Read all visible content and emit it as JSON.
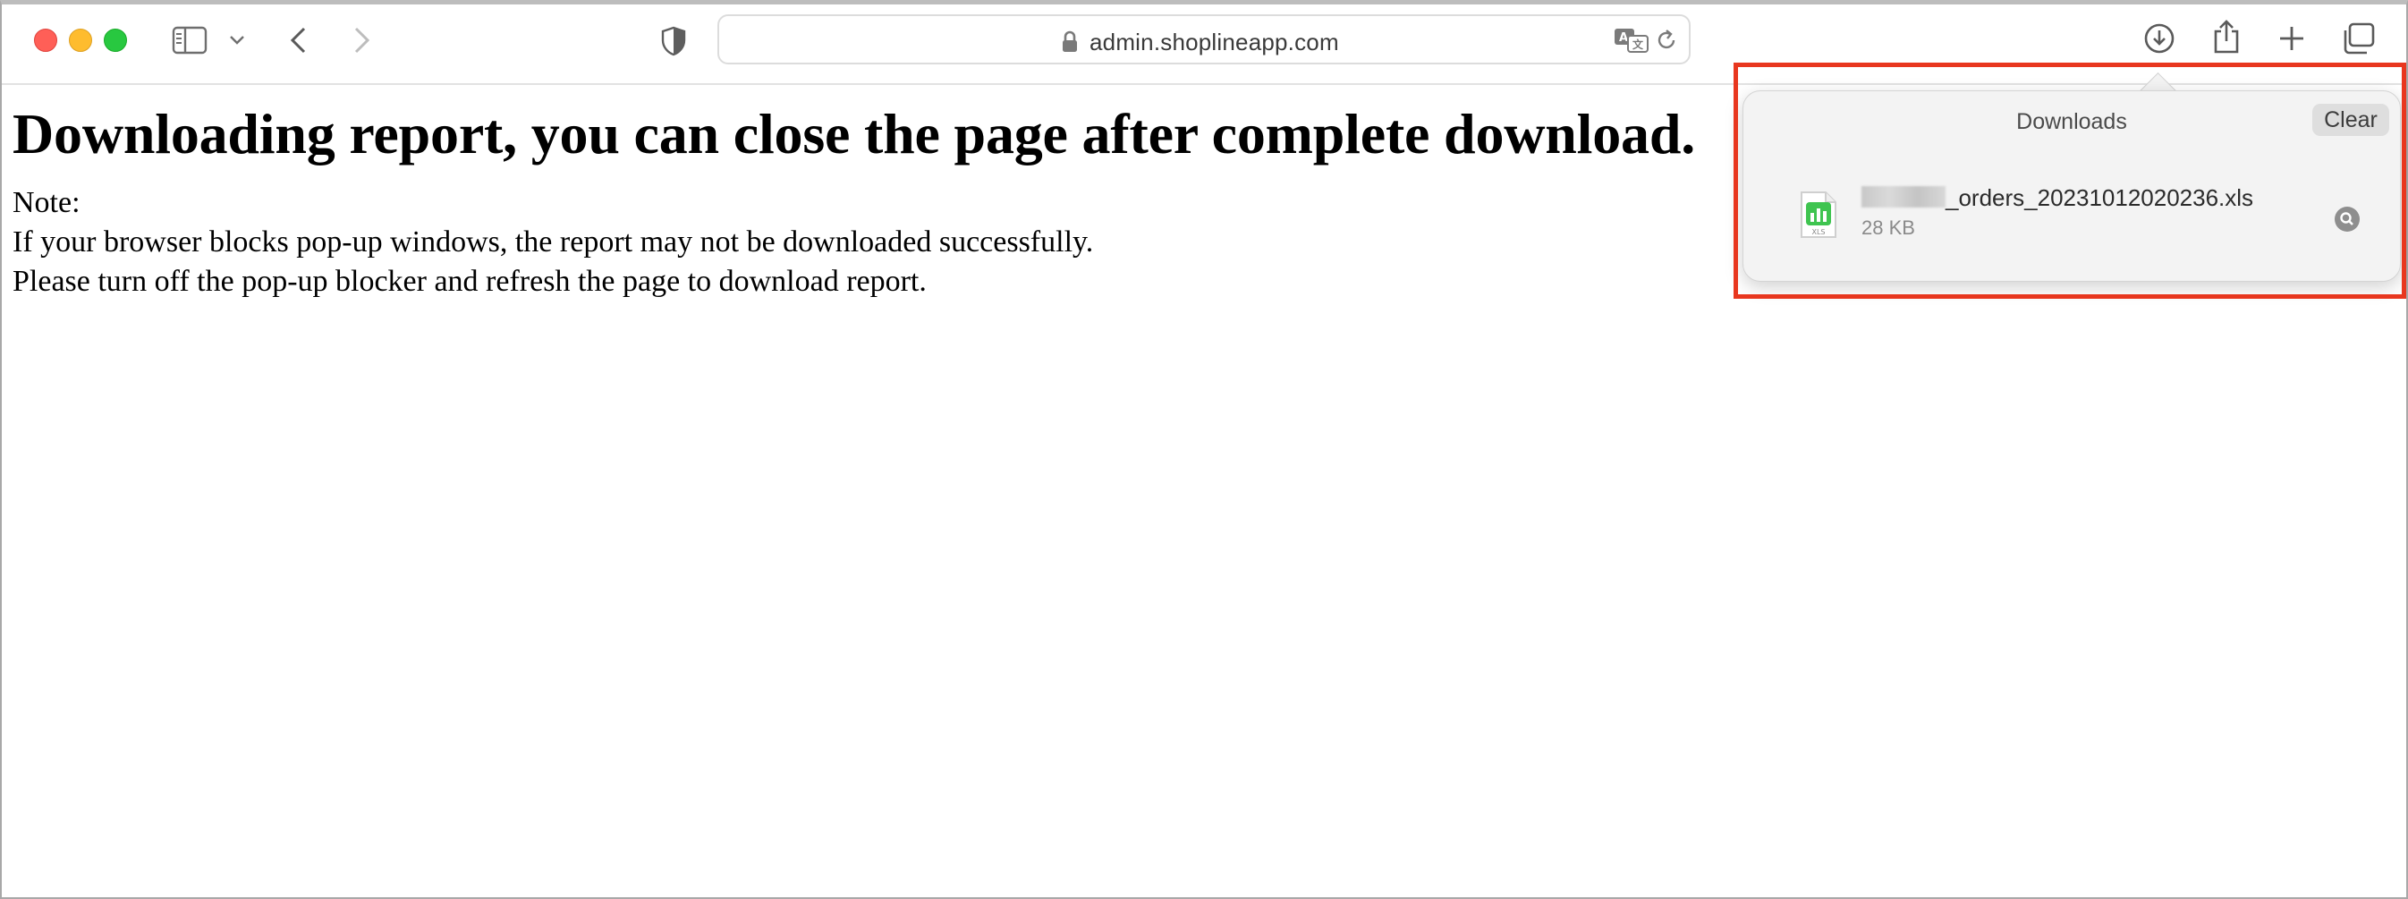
{
  "browser": {
    "url": "admin.shoplineapp.com",
    "icons": [
      "sidebar-icon",
      "chevron-down-icon",
      "back-icon",
      "forward-icon",
      "privacy-shield-icon",
      "lock-icon",
      "translate-icon",
      "reload-icon",
      "downloads-icon",
      "share-icon",
      "new-tab-icon",
      "tab-overview-icon"
    ]
  },
  "page": {
    "heading": "Downloading report, you can close the page after complete download.",
    "note_label": "Note:",
    "note_line1": "If your browser blocks pop-up windows, the report may not be downloaded successfully.",
    "note_line2": "Please turn off the pop-up blocker and refresh the page to download report."
  },
  "downloads": {
    "title": "Downloads",
    "clear_label": "Clear",
    "items": [
      {
        "file_name_suffix": "_orders_20231012020236.xls",
        "file_size": "28 KB",
        "icon_label": "XLS"
      }
    ]
  },
  "colors": {
    "highlight": "#e8371f",
    "close": "#ff5f57",
    "minimize": "#febc2e",
    "zoom": "#28c840",
    "spreadsheet": "#3fc450"
  }
}
